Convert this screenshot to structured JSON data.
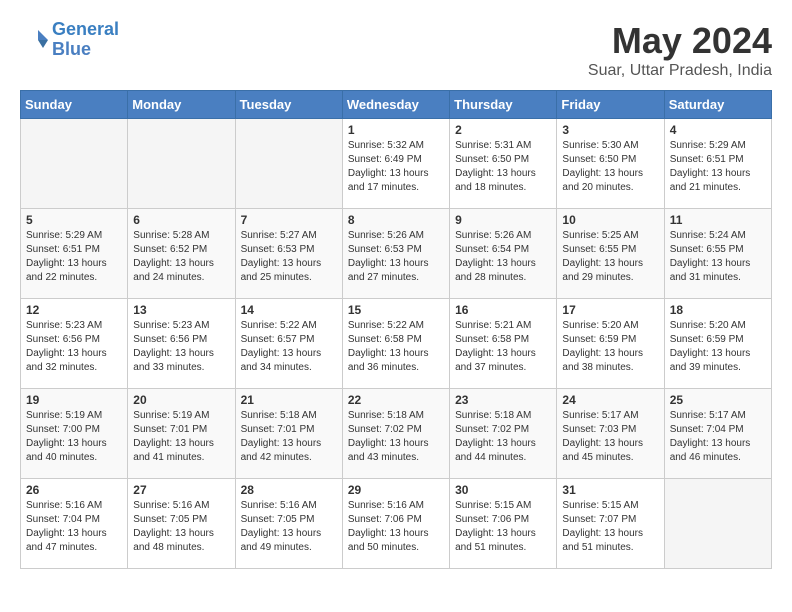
{
  "logo": {
    "line1": "General",
    "line2": "Blue"
  },
  "title": "May 2024",
  "subtitle": "Suar, Uttar Pradesh, India",
  "days_of_week": [
    "Sunday",
    "Monday",
    "Tuesday",
    "Wednesday",
    "Thursday",
    "Friday",
    "Saturday"
  ],
  "weeks": [
    [
      {
        "day": "",
        "info": ""
      },
      {
        "day": "",
        "info": ""
      },
      {
        "day": "",
        "info": ""
      },
      {
        "day": "1",
        "info": "Sunrise: 5:32 AM\nSunset: 6:49 PM\nDaylight: 13 hours and 17 minutes."
      },
      {
        "day": "2",
        "info": "Sunrise: 5:31 AM\nSunset: 6:50 PM\nDaylight: 13 hours and 18 minutes."
      },
      {
        "day": "3",
        "info": "Sunrise: 5:30 AM\nSunset: 6:50 PM\nDaylight: 13 hours and 20 minutes."
      },
      {
        "day": "4",
        "info": "Sunrise: 5:29 AM\nSunset: 6:51 PM\nDaylight: 13 hours and 21 minutes."
      }
    ],
    [
      {
        "day": "5",
        "info": "Sunrise: 5:29 AM\nSunset: 6:51 PM\nDaylight: 13 hours and 22 minutes."
      },
      {
        "day": "6",
        "info": "Sunrise: 5:28 AM\nSunset: 6:52 PM\nDaylight: 13 hours and 24 minutes."
      },
      {
        "day": "7",
        "info": "Sunrise: 5:27 AM\nSunset: 6:53 PM\nDaylight: 13 hours and 25 minutes."
      },
      {
        "day": "8",
        "info": "Sunrise: 5:26 AM\nSunset: 6:53 PM\nDaylight: 13 hours and 27 minutes."
      },
      {
        "day": "9",
        "info": "Sunrise: 5:26 AM\nSunset: 6:54 PM\nDaylight: 13 hours and 28 minutes."
      },
      {
        "day": "10",
        "info": "Sunrise: 5:25 AM\nSunset: 6:55 PM\nDaylight: 13 hours and 29 minutes."
      },
      {
        "day": "11",
        "info": "Sunrise: 5:24 AM\nSunset: 6:55 PM\nDaylight: 13 hours and 31 minutes."
      }
    ],
    [
      {
        "day": "12",
        "info": "Sunrise: 5:23 AM\nSunset: 6:56 PM\nDaylight: 13 hours and 32 minutes."
      },
      {
        "day": "13",
        "info": "Sunrise: 5:23 AM\nSunset: 6:56 PM\nDaylight: 13 hours and 33 minutes."
      },
      {
        "day": "14",
        "info": "Sunrise: 5:22 AM\nSunset: 6:57 PM\nDaylight: 13 hours and 34 minutes."
      },
      {
        "day": "15",
        "info": "Sunrise: 5:22 AM\nSunset: 6:58 PM\nDaylight: 13 hours and 36 minutes."
      },
      {
        "day": "16",
        "info": "Sunrise: 5:21 AM\nSunset: 6:58 PM\nDaylight: 13 hours and 37 minutes."
      },
      {
        "day": "17",
        "info": "Sunrise: 5:20 AM\nSunset: 6:59 PM\nDaylight: 13 hours and 38 minutes."
      },
      {
        "day": "18",
        "info": "Sunrise: 5:20 AM\nSunset: 6:59 PM\nDaylight: 13 hours and 39 minutes."
      }
    ],
    [
      {
        "day": "19",
        "info": "Sunrise: 5:19 AM\nSunset: 7:00 PM\nDaylight: 13 hours and 40 minutes."
      },
      {
        "day": "20",
        "info": "Sunrise: 5:19 AM\nSunset: 7:01 PM\nDaylight: 13 hours and 41 minutes."
      },
      {
        "day": "21",
        "info": "Sunrise: 5:18 AM\nSunset: 7:01 PM\nDaylight: 13 hours and 42 minutes."
      },
      {
        "day": "22",
        "info": "Sunrise: 5:18 AM\nSunset: 7:02 PM\nDaylight: 13 hours and 43 minutes."
      },
      {
        "day": "23",
        "info": "Sunrise: 5:18 AM\nSunset: 7:02 PM\nDaylight: 13 hours and 44 minutes."
      },
      {
        "day": "24",
        "info": "Sunrise: 5:17 AM\nSunset: 7:03 PM\nDaylight: 13 hours and 45 minutes."
      },
      {
        "day": "25",
        "info": "Sunrise: 5:17 AM\nSunset: 7:04 PM\nDaylight: 13 hours and 46 minutes."
      }
    ],
    [
      {
        "day": "26",
        "info": "Sunrise: 5:16 AM\nSunset: 7:04 PM\nDaylight: 13 hours and 47 minutes."
      },
      {
        "day": "27",
        "info": "Sunrise: 5:16 AM\nSunset: 7:05 PM\nDaylight: 13 hours and 48 minutes."
      },
      {
        "day": "28",
        "info": "Sunrise: 5:16 AM\nSunset: 7:05 PM\nDaylight: 13 hours and 49 minutes."
      },
      {
        "day": "29",
        "info": "Sunrise: 5:16 AM\nSunset: 7:06 PM\nDaylight: 13 hours and 50 minutes."
      },
      {
        "day": "30",
        "info": "Sunrise: 5:15 AM\nSunset: 7:06 PM\nDaylight: 13 hours and 51 minutes."
      },
      {
        "day": "31",
        "info": "Sunrise: 5:15 AM\nSunset: 7:07 PM\nDaylight: 13 hours and 51 minutes."
      },
      {
        "day": "",
        "info": ""
      }
    ]
  ]
}
